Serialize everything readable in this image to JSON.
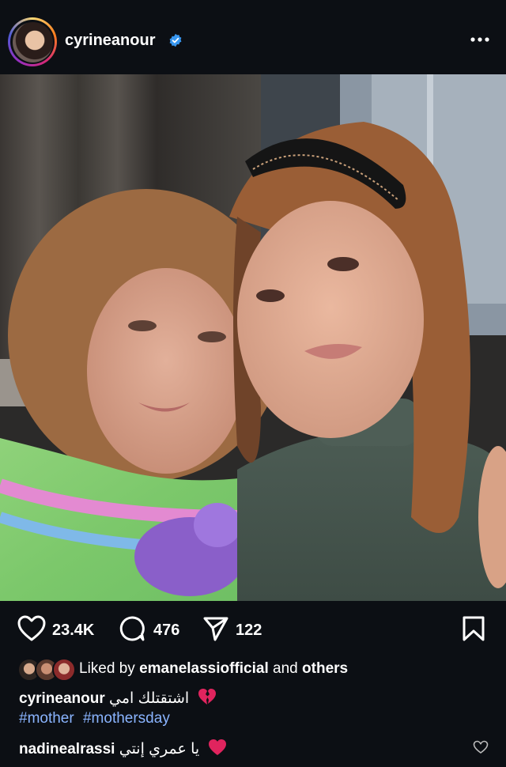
{
  "post": {
    "username": "cyrineanour",
    "verified": true
  },
  "actions": {
    "likes": "23.4K",
    "comments": "476",
    "shares": "122"
  },
  "liked_by": {
    "prefix": "Liked by",
    "user": "emanelassiofficial",
    "and": "and",
    "others": "others"
  },
  "caption": {
    "username": "cyrineanour",
    "text": "اشتقتلك امي",
    "emoji": "broken-heart-icon"
  },
  "hashtags": [
    "#mother",
    "#mothersday"
  ],
  "comment": {
    "username": "nadinealrassi",
    "text": "يا عمري إنتي",
    "emoji": "red-heart-icon"
  },
  "colors": {
    "background": "#0c0f14",
    "verified_blue": "#3897f0",
    "hashtag": "#8ab4ff",
    "heart_red": "#e0245e"
  }
}
